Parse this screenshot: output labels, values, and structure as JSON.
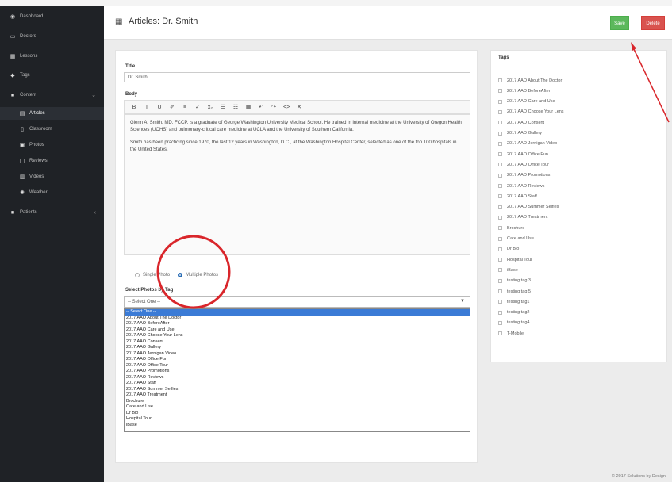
{
  "sidebar": {
    "items": [
      {
        "label": "Dashboard",
        "icon": "dashboard-icon",
        "glyph": "◉"
      },
      {
        "label": "Doctors",
        "icon": "monitor-icon",
        "glyph": "▭"
      },
      {
        "label": "Lessons",
        "icon": "grid-icon",
        "glyph": "▦"
      },
      {
        "label": "Tags",
        "icon": "tag-icon",
        "glyph": "◆"
      },
      {
        "label": "Content",
        "icon": "folder-icon",
        "glyph": "■"
      },
      {
        "label": "Articles",
        "icon": "list-icon",
        "glyph": "▤"
      },
      {
        "label": "Classroom",
        "icon": "file-icon",
        "glyph": "▯"
      },
      {
        "label": "Photos",
        "icon": "image-icon",
        "glyph": "▣"
      },
      {
        "label": "Reviews",
        "icon": "comment-icon",
        "glyph": "▢"
      },
      {
        "label": "Videos",
        "icon": "film-icon",
        "glyph": "▥"
      },
      {
        "label": "Weather",
        "icon": "sun-icon",
        "glyph": "✺"
      },
      {
        "label": "Patients",
        "icon": "folder-icon",
        "glyph": "■"
      }
    ]
  },
  "header": {
    "icon": "table-icon",
    "title": "Articles: Dr. Smith",
    "save_label": "Save",
    "delete_label": "Delete"
  },
  "form": {
    "title_label": "Title",
    "title_value": "Dr. Smith",
    "body_label": "Body",
    "toolbar_glyphs": [
      "B",
      "I",
      "U",
      "✐",
      "≡",
      "✓",
      "x₂",
      "☰",
      "☷",
      "▦",
      "↶",
      "↷",
      "<>",
      "✕"
    ],
    "body_p1": "Glenn A. Smith, MD, FCCP, is a graduate of George Washington University Medical School. He trained in internal medicine at the University of Oregon Health Sciences (UOHS) and pulmonary-critical care medicine at UCLA and the University of Southern California.",
    "body_p2": "Smith has been practicing since 1970, the last 12 years in Washington, D.C., at the Washington Hospital Center, selected as one of the top 100 hospitals in the United States.",
    "radio_single": "Single Photo",
    "radio_multiple": "Multiple Photos",
    "select_label": "Select Photos by Tag",
    "select_value": "-- Select One --",
    "options": [
      "-- Select One --",
      "2017 AAO About The Doctor",
      "2017 AAO BeforeAfter",
      "2017 AAO Care and Use",
      "2017 AAO Choose Your Lens",
      "2017 AAO Consent",
      "2017 AAO Gallery",
      "2017 AAO Jernigan Video",
      "2017 AAO Office Fun",
      "2017 AAO Office Tour",
      "2017 AAO Promotions",
      "2017 AAO Reviews",
      "2017 AAO Staff",
      "2017 AAO Summer Selfies",
      "2017 AAO Treatment",
      "Brochure",
      "Care and Use",
      "Dr Bio",
      "Hospital Tour",
      "iBase"
    ]
  },
  "tags": {
    "label": "Tags",
    "items": [
      "2017 AAO About The Doctor",
      "2017 AAO BeforeAfter",
      "2017 AAO Care and Use",
      "2017 AAO Choose Your Lens",
      "2017 AAO Consent",
      "2017 AAO Gallery",
      "2017 AAO Jernigan Video",
      "2017 AAO Office Fun",
      "2017 AAO Office Tour",
      "2017 AAO Promotions",
      "2017 AAO Reviews",
      "2017 AAO Staff",
      "2017 AAO Summer Selfies",
      "2017 AAO Treatment",
      "Brochure",
      "Care and Use",
      "Dr Bio",
      "Hospital Tour",
      "iBase",
      "testing tag 3",
      "testing tag 5",
      "testing tag1",
      "testing tag2",
      "testing tag4",
      "T-Mobile"
    ]
  },
  "footer": "© 2017 Solutions by Design",
  "colors": {
    "save": "#5cb85c",
    "delete": "#d9534f",
    "selection": "#3b7bd6",
    "annotation": "#d9262b"
  }
}
